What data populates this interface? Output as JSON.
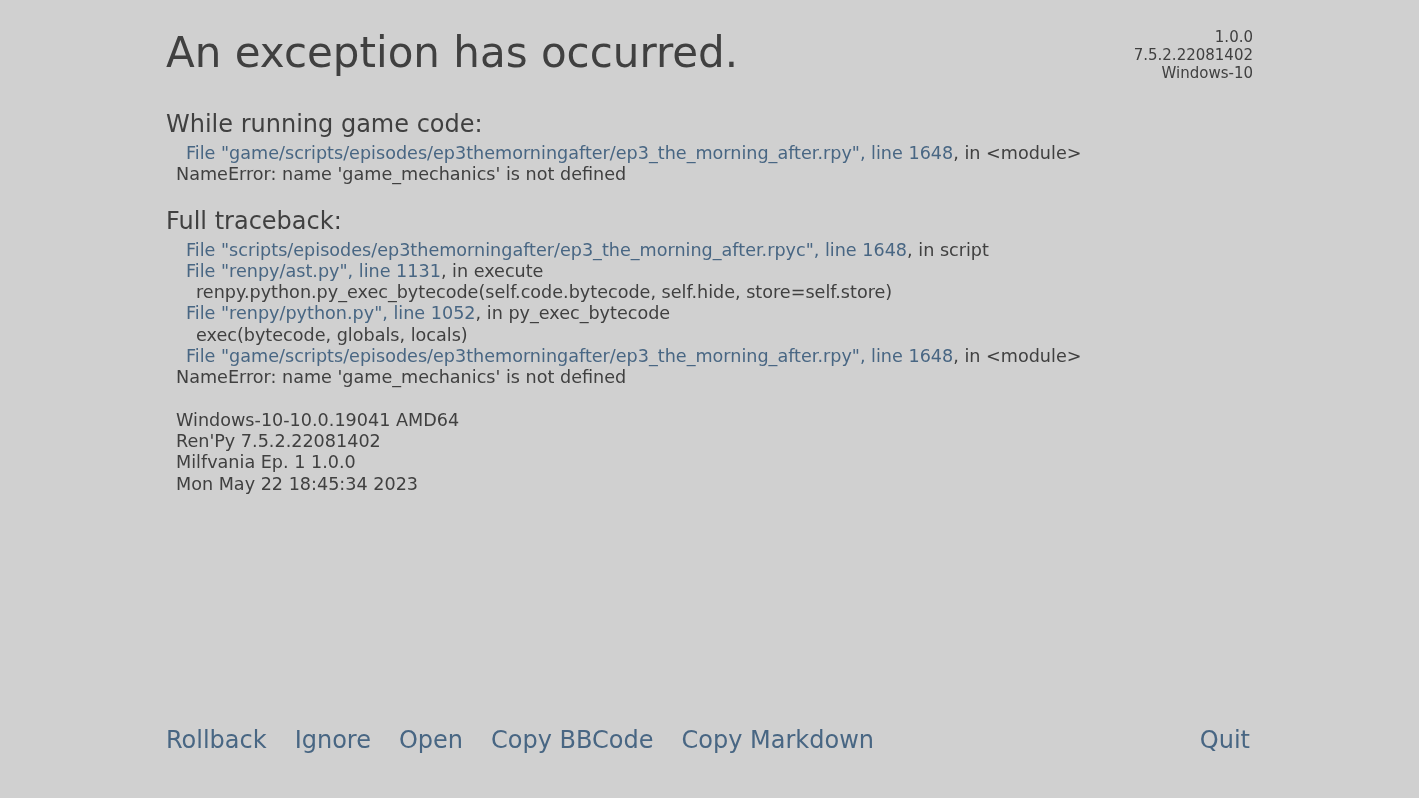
{
  "title": "An exception has occurred.",
  "version_info": [
    "1.0.0",
    "7.5.2.22081402",
    "Windows-10"
  ],
  "sections": [
    {
      "heading": "While running game code:",
      "lines": [
        {
          "kind": "frame",
          "link": "File \"game/scripts/episodes/ep3themorningafter/ep3_the_morning_after.rpy\", line 1648",
          "text": ", in <module>"
        },
        {
          "kind": "error",
          "text": "NameError: name 'game_mechanics' is not defined"
        }
      ]
    },
    {
      "heading": "Full traceback:",
      "lines": [
        {
          "kind": "frame",
          "link": "File \"scripts/episodes/ep3themorningafter/ep3_the_morning_after.rpyc\", line 1648",
          "text": ", in script"
        },
        {
          "kind": "frame",
          "link": "File \"renpy/ast.py\", line 1131",
          "text": ", in execute"
        },
        {
          "kind": "code",
          "text": "renpy.python.py_exec_bytecode(self.code.bytecode, self.hide, store=self.store)"
        },
        {
          "kind": "frame",
          "link": "File \"renpy/python.py\", line 1052",
          "text": ", in py_exec_bytecode"
        },
        {
          "kind": "code",
          "text": "exec(bytecode, globals, locals)"
        },
        {
          "kind": "frame",
          "link": "File \"game/scripts/episodes/ep3themorningafter/ep3_the_morning_after.rpy\", line 1648",
          "text": ", in <module>"
        },
        {
          "kind": "error",
          "text": "NameError: name 'game_mechanics' is not defined"
        }
      ]
    }
  ],
  "system_info": [
    "Windows-10-10.0.19041 AMD64",
    "Ren'Py 7.5.2.22081402",
    "Milfvania Ep. 1 1.0.0",
    "Mon May 22 18:45:34 2023"
  ],
  "buttons": [
    {
      "label": "Rollback"
    },
    {
      "label": "Ignore"
    },
    {
      "label": "Open"
    },
    {
      "label": "Copy BBCode"
    },
    {
      "label": "Copy Markdown"
    }
  ],
  "quit_button": {
    "label": "Quit"
  }
}
